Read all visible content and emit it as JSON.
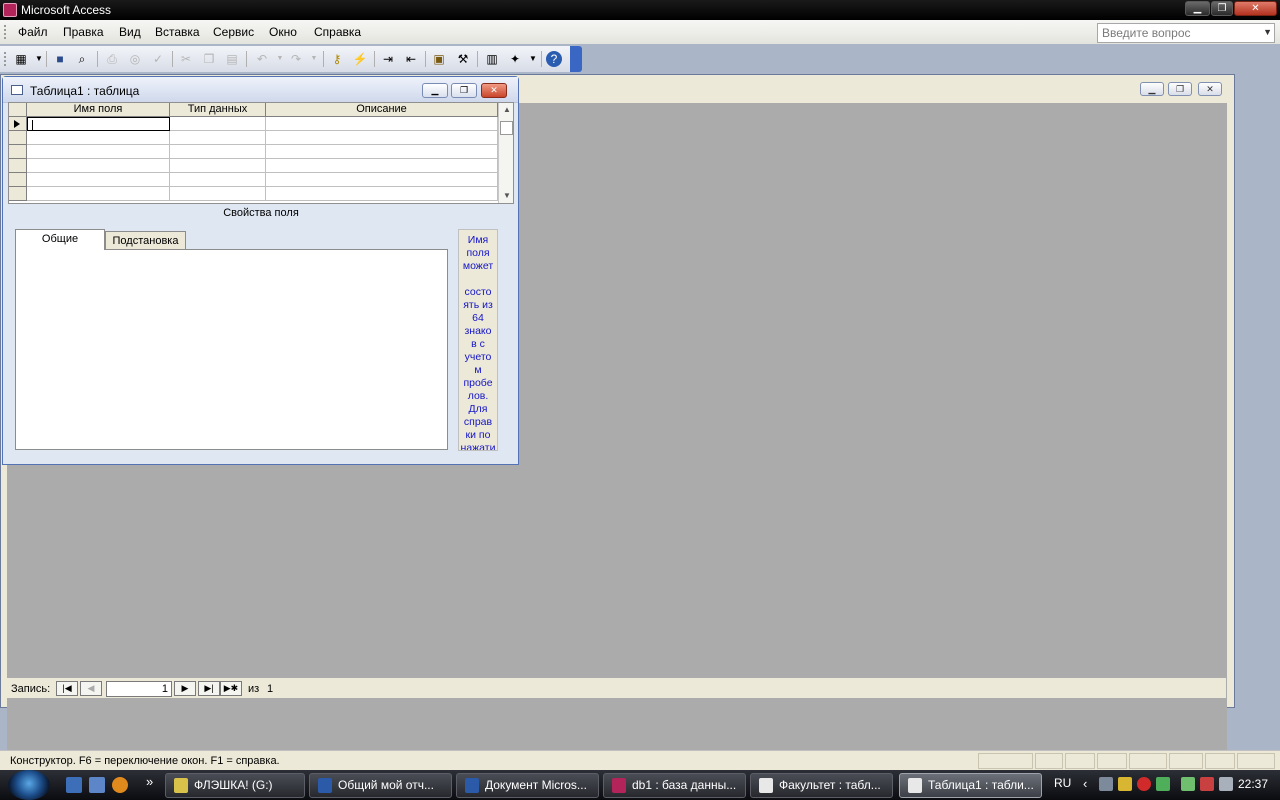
{
  "app": {
    "title": "Microsoft Access"
  },
  "menu": {
    "items": [
      "Файл",
      "Правка",
      "Вид",
      "Вставка",
      "Сервис",
      "Окно",
      "Справка"
    ],
    "ask_placeholder": "Введите вопрос"
  },
  "toolbar": {
    "icons": [
      "view-icon",
      "save-icon",
      "file-search-icon",
      "print-icon",
      "print-preview-icon",
      "spelling-icon",
      "cut-icon",
      "copy-icon",
      "paste-icon",
      "undo-icon",
      "redo-icon",
      "primary-key-icon",
      "indexes-icon",
      "insert-rows-icon",
      "delete-rows-icon",
      "properties-icon",
      "build-icon",
      "database-window-icon",
      "new-object-icon",
      "help-icon"
    ]
  },
  "design_window": {
    "title": "Таблица1 : таблица",
    "columns": [
      "Имя поля",
      "Тип данных",
      "Описание"
    ],
    "field_properties_title": "Свойства поля",
    "tabs": [
      "Общие",
      "Подстановка"
    ],
    "help_text": "Имя\nполя\nможет\n\nсосто\nять из\n64\nзнако\nв с\nучето\nм\nпробе\nлов.\nДля\nсправ\nки по\nнажати"
  },
  "record_nav": {
    "label": "Запись:",
    "current": "1",
    "of_label": "из",
    "total": "1"
  },
  "status": {
    "text": "Конструктор.  F6 = переключение окон.  F1 = справка."
  },
  "taskbar": {
    "tasks": [
      "ФЛЭШКА! (G:)",
      "Общий мой отч...",
      "Документ Micros...",
      "db1 : база данны...",
      "Факультет : табл...",
      "Таблица1 : табли..."
    ],
    "lang": "RU",
    "time": "22:37"
  },
  "colors": {
    "help_text": "#1414c8",
    "taskbar": "#1a1c21",
    "title_bar": "#000000"
  }
}
